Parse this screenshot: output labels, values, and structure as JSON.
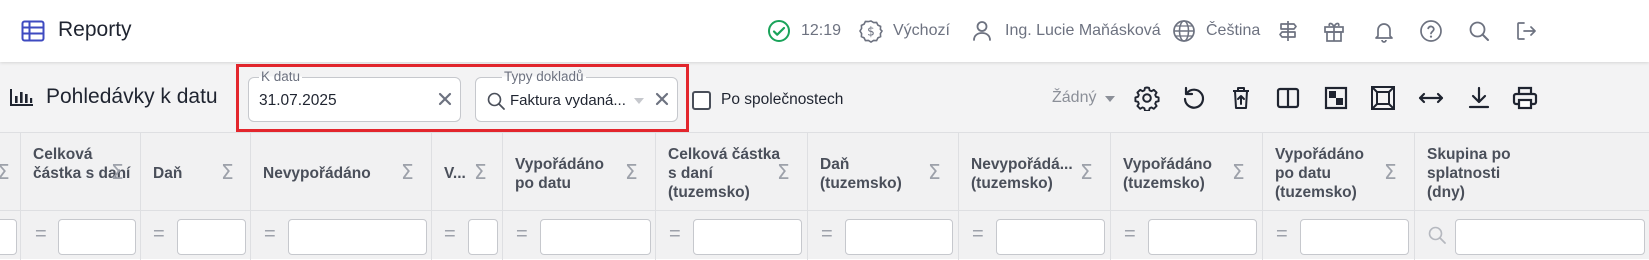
{
  "app": {
    "title": "Reporty",
    "icon": "table-icon"
  },
  "topbar": {
    "time": "12:19",
    "currency": "Výchozí",
    "user": "Ing. Lucie Maňásková",
    "language": "Čeština"
  },
  "report": {
    "title": "Pohledávky k datu"
  },
  "filters": {
    "date_label": "K datu",
    "date_value": "31.07.2025",
    "types_label": "Typy dokladů",
    "types_value": "Faktura vydaná..."
  },
  "checkbox": {
    "label": "Po společnostech",
    "checked": false
  },
  "view_select": {
    "value": "Žádný"
  },
  "columns": [
    {
      "title": "Celková částka s daní"
    },
    {
      "title": "Daň"
    },
    {
      "title": "Nevypořádáno"
    },
    {
      "title": "V..."
    },
    {
      "title": "Vypořádáno po datu"
    },
    {
      "title": "Celková částka s daní (tuzemsko)"
    },
    {
      "title": "Daň (tuzemsko)"
    },
    {
      "title": "Nevypořádá... (tuzemsko)"
    },
    {
      "title": "Vypořádáno (tuzemsko)"
    },
    {
      "title": "Vypořádáno po datu (tuzemsko)"
    },
    {
      "title": "Skupina po splatnosti (dny)"
    }
  ],
  "colors": {
    "accent": "#3e4ac0",
    "success": "#1aa35a",
    "highlight": "#e3262d"
  }
}
